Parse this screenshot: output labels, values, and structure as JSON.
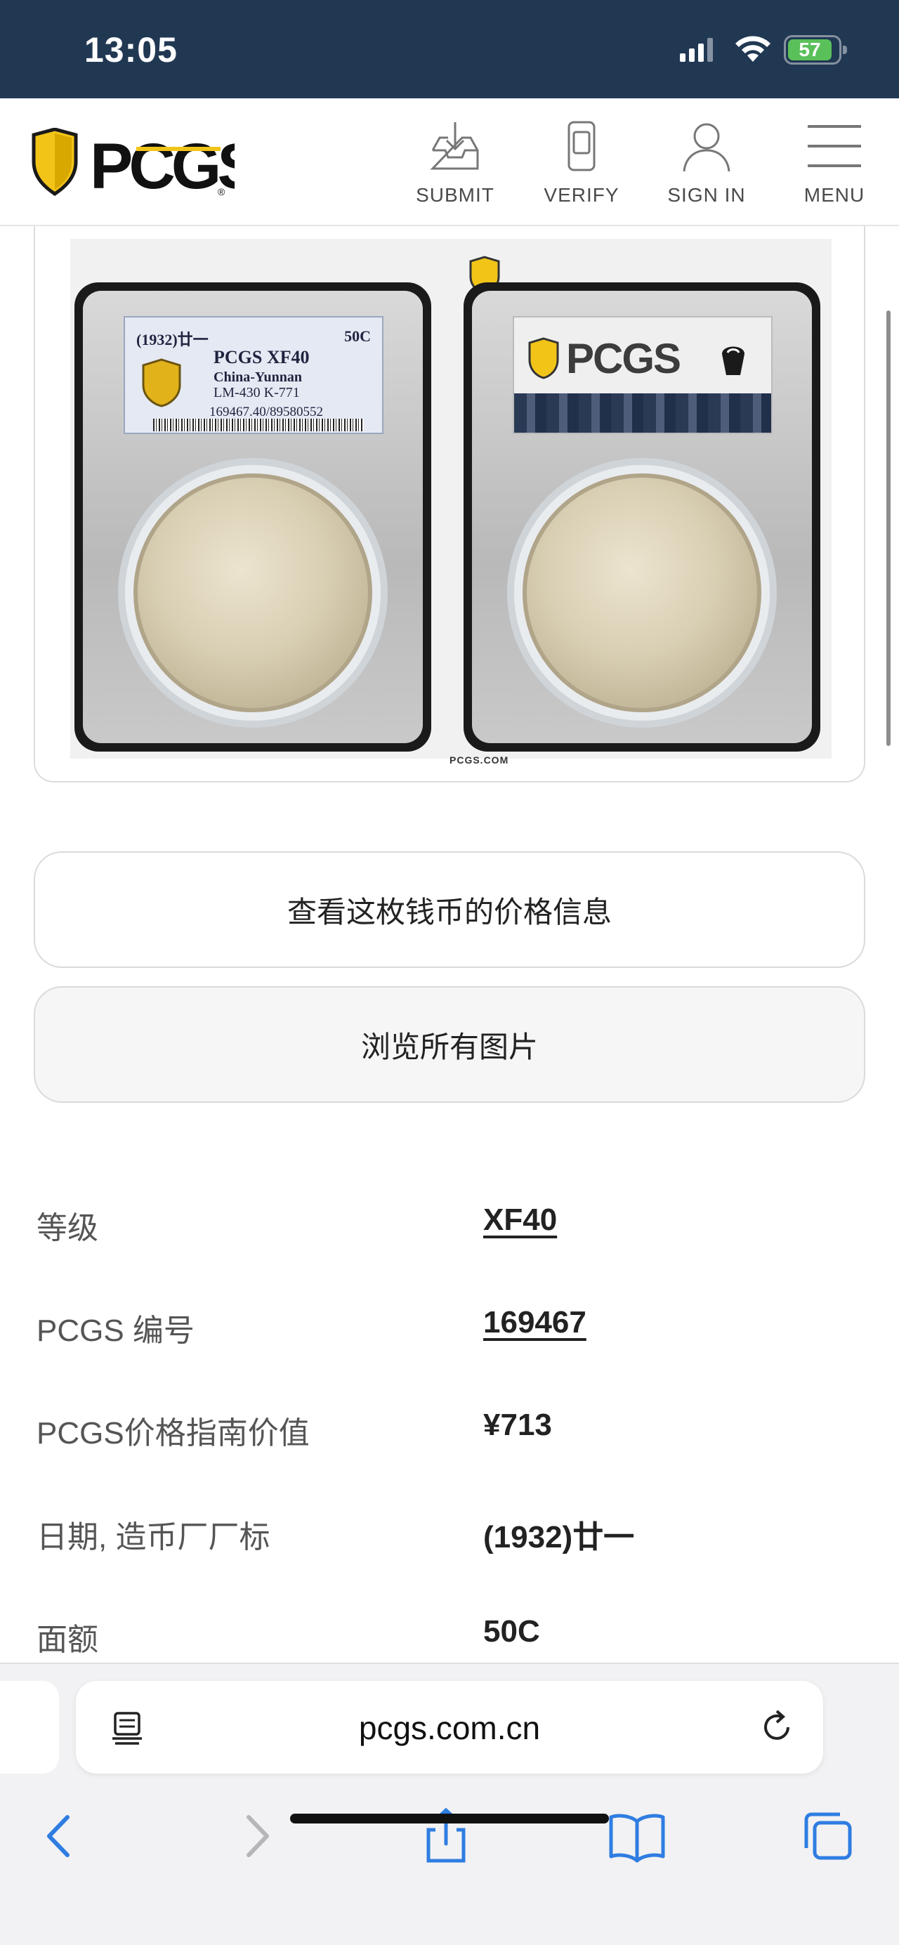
{
  "status_bar": {
    "time": "13:05",
    "battery": "57"
  },
  "header": {
    "logo_alt": "PCGS",
    "nav": [
      {
        "label": "SUBMIT",
        "icon": "inbox-download-icon"
      },
      {
        "label": "VERIFY",
        "icon": "phone-device-icon"
      },
      {
        "label": "SIGN IN",
        "icon": "user-icon"
      },
      {
        "label": "MENU",
        "icon": "hamburger-icon"
      }
    ]
  },
  "coin_image": {
    "label": {
      "date": "(1932)廿一",
      "denomination": "50C",
      "grade": "PCGS XF40",
      "region": "China-Yunnan",
      "catalog": "LM-430 K-771",
      "cert": "169467.40/89580552"
    },
    "reverse_logo": "PCGS",
    "footer": "PCGS.COM"
  },
  "buttons": {
    "price_info": "查看这枚钱币的价格信息",
    "browse_photos": "浏览所有图片"
  },
  "details": [
    {
      "key": "等级",
      "value": "XF40",
      "link": true
    },
    {
      "key": "PCGS 编号",
      "value": "169467",
      "link": true
    },
    {
      "key": "PCGS价格指南价值",
      "value": "¥713",
      "link": false
    },
    {
      "key": "日期, 造币厂厂标",
      "value": "(1932)廿一",
      "link": false
    },
    {
      "key": "面额",
      "value": "50C",
      "link": false
    }
  ],
  "browser": {
    "url": "pcgs.com.cn",
    "toolbar": [
      "back-icon",
      "forward-icon",
      "share-icon",
      "bookmarks-icon",
      "tabs-icon"
    ]
  },
  "colors": {
    "status_bar_bg": "#213853",
    "pcgs_gold": "#f2c418",
    "link_text": "#222222",
    "ios_blue": "#2f7de1"
  }
}
